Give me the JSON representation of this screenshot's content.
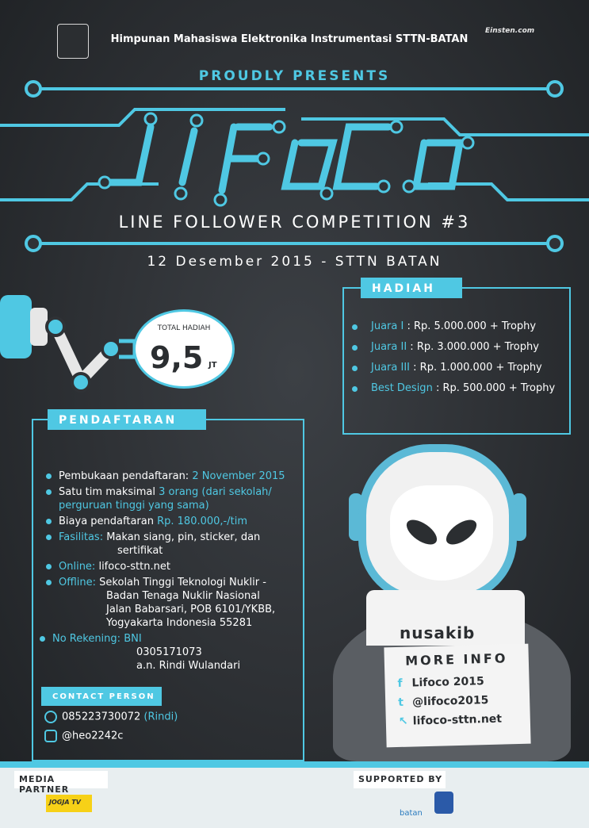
{
  "header": {
    "org_name": "Himpunan Mahasiswa Elektronika Instrumentasi STTN-BATAN",
    "sponsor_logo_text": "Einsten.com",
    "proudly": "PROUDLY PRESENTS",
    "event_logo": "LIFOCO",
    "event_subtitle": "LINE FOLLOWER COMPETITION #3",
    "event_date": "12 Desember 2015 - STTN BATAN"
  },
  "total": {
    "label": "TOTAL HADIAH",
    "value": "9,5",
    "unit": "JT"
  },
  "hadiah": {
    "title": "HADIAH",
    "prizes": [
      {
        "label": "Juara I",
        "value": "Rp. 5.000.000 + Trophy"
      },
      {
        "label": "Juara II",
        "value": "Rp. 3.000.000 + Trophy"
      },
      {
        "label": "Juara III",
        "value": "Rp. 1.000.000 + Trophy"
      },
      {
        "label": "Best Design",
        "value": "Rp. 500.000 + Trophy"
      }
    ]
  },
  "pendaftaran": {
    "title": "PENDAFTARAN",
    "opening_label": "Pembukaan pendaftaran:",
    "opening_value": "2 November 2015",
    "team_text": "Satu tim maksimal",
    "team_value": "3 orang (dari sekolah/",
    "team_value2": "perguruan tinggi yang sama)",
    "fee_label": "Biaya pendaftaran",
    "fee_value": "Rp. 180.000,-/tim",
    "facility_label": "Fasilitas:",
    "facility_value": "Makan siang, pin, sticker, dan",
    "facility_value2": "sertifikat",
    "online_label": "Online:",
    "online_value": "lifoco-sttn.net",
    "offline_label": "Offline:",
    "offline_lines": [
      "Sekolah Tinggi Teknologi Nuklir -",
      "Badan Tenaga Nuklir Nasional",
      "Jalan Babarsari, POB 6101/YKBB,",
      "Yogyakarta Indonesia 55281"
    ],
    "rekening_label": "No Rekening:",
    "rekening_bank": "BNI",
    "rekening_number": "0305171073",
    "rekening_name": "a.n. Rindi Wulandari"
  },
  "contact": {
    "title": "CONTACT PERSON",
    "phone": "085223730072",
    "phone_name": "(Rindi)",
    "line_id": "@heo2242c"
  },
  "robot": {
    "chest_logo": "nusakib"
  },
  "more_info": {
    "title": "MORE INFO",
    "facebook": "Lifoco 2015",
    "twitter": "@lifoco2015",
    "website": "lifoco-sttn.net"
  },
  "footer": {
    "media_partner": "MEDIA PARTNER",
    "media_partner_logo": "JOGJA TV",
    "supported_by": "SUPPORTED BY",
    "supporter_logo": "batan"
  },
  "colors": {
    "accent": "#4fc8e3",
    "background": "#2f3236",
    "card": "#f4f4f4"
  },
  "icons": [
    "phone-icon",
    "line-icon",
    "facebook-icon",
    "twitter-icon",
    "cursor-icon"
  ]
}
